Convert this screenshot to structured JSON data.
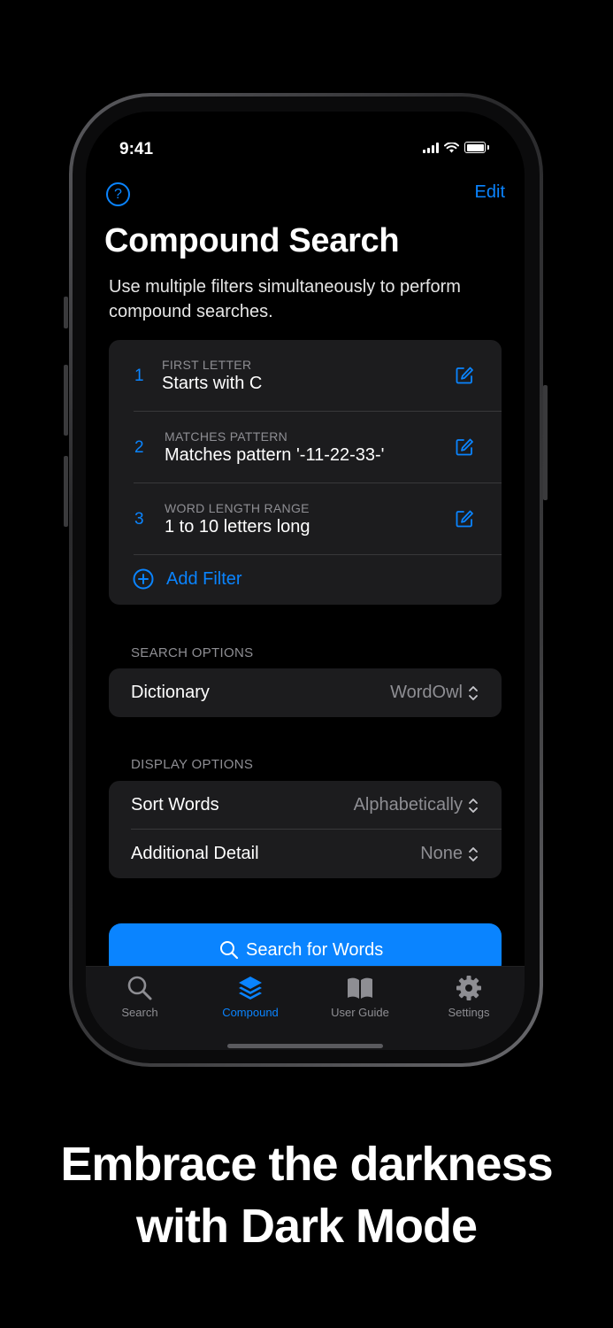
{
  "status": {
    "time": "9:41"
  },
  "nav": {
    "help_glyph": "?",
    "edit_label": "Edit"
  },
  "header": {
    "title": "Compound Search",
    "subtitle": "Use multiple filters simultaneously to perform compound searches."
  },
  "filters": [
    {
      "number": "1",
      "caption": "FIRST LETTER",
      "value": "Starts with C",
      "icon": "edit-icon"
    },
    {
      "number": "2",
      "caption": "MATCHES PATTERN",
      "value": "Matches pattern '-11-22-33-'",
      "icon": "edit-icon"
    },
    {
      "number": "3",
      "caption": "WORD LENGTH RANGE",
      "value": "1 to 10 letters long",
      "icon": "edit-icon"
    }
  ],
  "add_filter": {
    "label": "Add Filter",
    "icon": "plus-circle-icon"
  },
  "search_options": {
    "header": "SEARCH OPTIONS",
    "dictionary": {
      "label": "Dictionary",
      "value": "WordOwl"
    }
  },
  "display_options": {
    "header": "DISPLAY OPTIONS",
    "sort": {
      "label": "Sort Words",
      "value": "Alphabetically"
    },
    "detail": {
      "label": "Additional Detail",
      "value": "None"
    }
  },
  "search_button": {
    "label": "Search for Words",
    "icon": "search-icon"
  },
  "tabs": [
    {
      "label": "Search",
      "icon": "magnifier-icon",
      "active": false
    },
    {
      "label": "Compound",
      "icon": "layers-icon",
      "active": true
    },
    {
      "label": "User Guide",
      "icon": "book-icon",
      "active": false
    },
    {
      "label": "Settings",
      "icon": "gear-icon",
      "active": false
    }
  ],
  "tagline": {
    "line1": "Embrace the darkness",
    "line2": "with Dark Mode"
  },
  "colors": {
    "accent": "#0a84ff",
    "background": "#000000",
    "card": "#1c1c1e",
    "secondary_text": "#8e8e93"
  }
}
